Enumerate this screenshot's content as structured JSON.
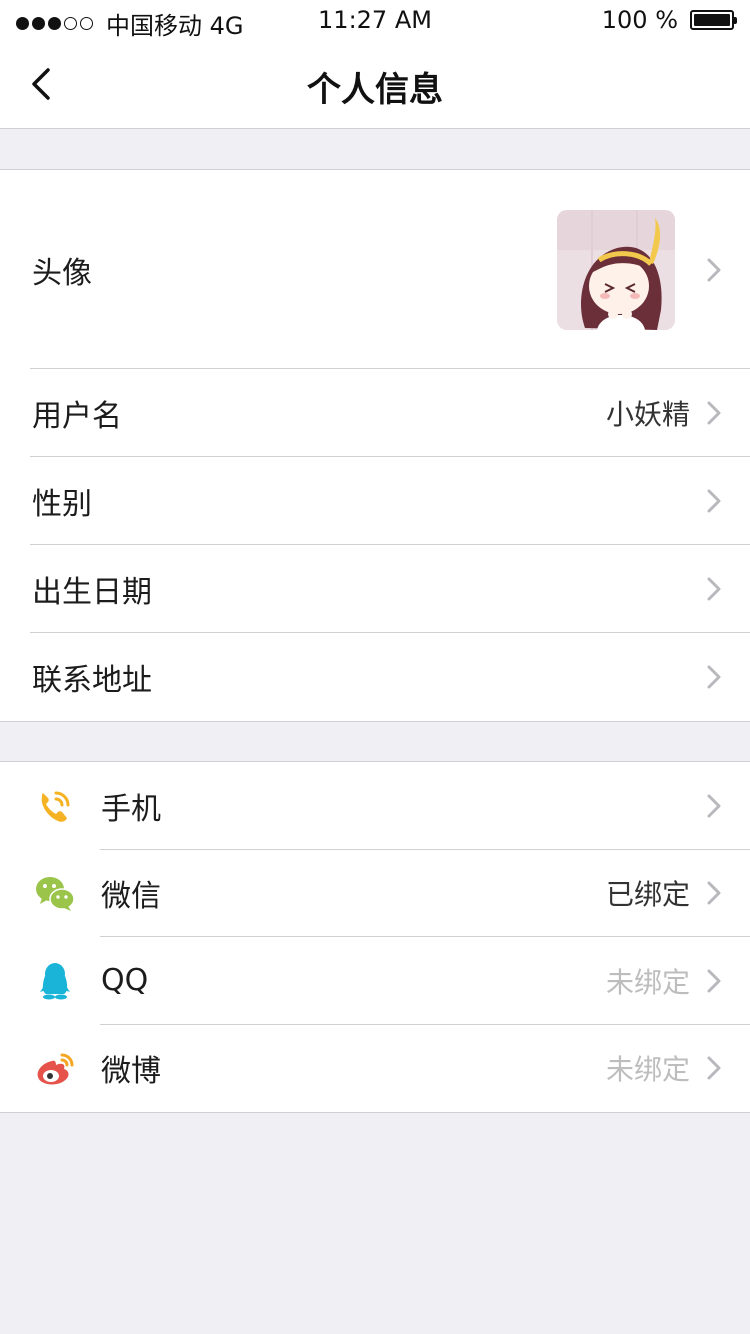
{
  "status_bar": {
    "carrier": "中国移动 4G",
    "time": "11:27 AM",
    "battery": "100 %"
  },
  "nav": {
    "title": "个人信息"
  },
  "profile": {
    "avatar_label": "头像",
    "username_label": "用户名",
    "username_value": "小妖精",
    "gender_label": "性别",
    "birthday_label": "出生日期",
    "address_label": "联系地址"
  },
  "bindings": [
    {
      "label": "手机",
      "icon": "phone-icon",
      "status": ""
    },
    {
      "label": "微信",
      "icon": "wechat-icon",
      "status": "已绑定"
    },
    {
      "label": "QQ",
      "icon": "qq-icon",
      "status": "未绑定"
    },
    {
      "label": "微博",
      "icon": "weibo-icon",
      "status": "未绑定"
    }
  ],
  "colors": {
    "background": "#efeff4",
    "divider": "#cfcfd4",
    "phone_icon": "#f5b223",
    "wechat_icon": "#9bc44a",
    "qq_icon": "#1ab4d8",
    "weibo_icon": "#e5534b",
    "unbound_text": "#bdbdbd"
  }
}
